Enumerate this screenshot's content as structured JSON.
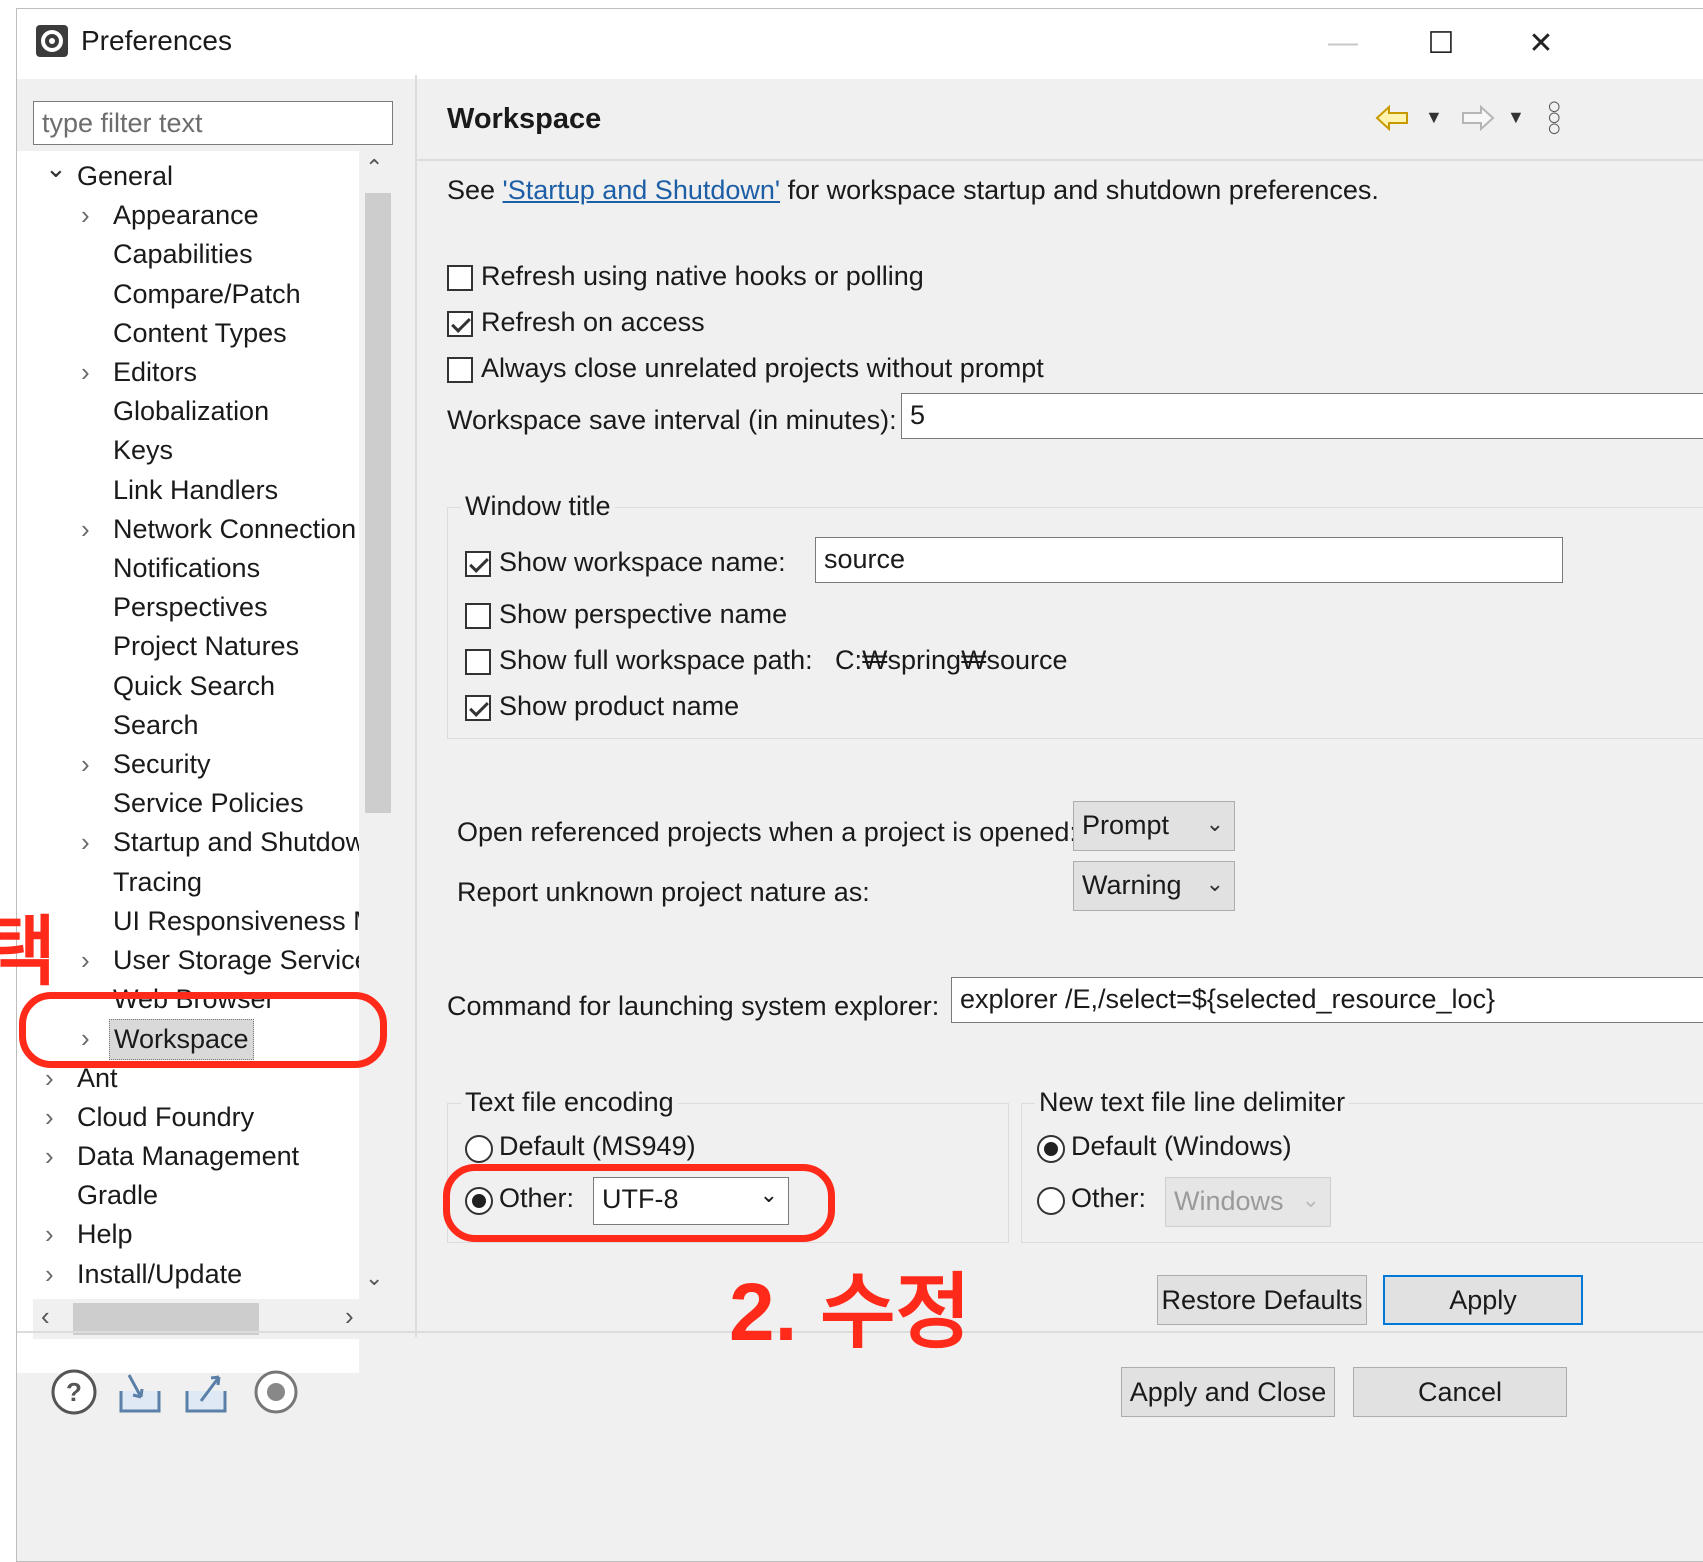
{
  "window": {
    "title": "Preferences",
    "minimize_glyph": "—",
    "maximize_glyph": "☐",
    "close_glyph": "✕"
  },
  "sidebar": {
    "filter_placeholder": "type filter text",
    "items": [
      {
        "label": "General",
        "level": 0,
        "expander": "expanded"
      },
      {
        "label": "Appearance",
        "level": 1,
        "expander": "collapsed"
      },
      {
        "label": "Capabilities",
        "level": 1,
        "expander": "none"
      },
      {
        "label": "Compare/Patch",
        "level": 1,
        "expander": "none"
      },
      {
        "label": "Content Types",
        "level": 1,
        "expander": "none"
      },
      {
        "label": "Editors",
        "level": 1,
        "expander": "collapsed"
      },
      {
        "label": "Globalization",
        "level": 1,
        "expander": "none"
      },
      {
        "label": "Keys",
        "level": 1,
        "expander": "none"
      },
      {
        "label": "Link Handlers",
        "level": 1,
        "expander": "none"
      },
      {
        "label": "Network Connection",
        "level": 1,
        "expander": "collapsed"
      },
      {
        "label": "Notifications",
        "level": 1,
        "expander": "none"
      },
      {
        "label": "Perspectives",
        "level": 1,
        "expander": "none"
      },
      {
        "label": "Project Natures",
        "level": 1,
        "expander": "none"
      },
      {
        "label": "Quick Search",
        "level": 1,
        "expander": "none"
      },
      {
        "label": "Search",
        "level": 1,
        "expander": "none"
      },
      {
        "label": "Security",
        "level": 1,
        "expander": "collapsed"
      },
      {
        "label": "Service Policies",
        "level": 1,
        "expander": "none"
      },
      {
        "label": "Startup and Shutdow",
        "level": 1,
        "expander": "collapsed"
      },
      {
        "label": "Tracing",
        "level": 1,
        "expander": "none"
      },
      {
        "label": "UI Responsiveness M",
        "level": 1,
        "expander": "none"
      },
      {
        "label": "User Storage Service",
        "level": 1,
        "expander": "collapsed"
      },
      {
        "label": "Web Browser",
        "level": 1,
        "expander": "none"
      },
      {
        "label": "Workspace",
        "level": 1,
        "expander": "collapsed",
        "selected": true
      },
      {
        "label": "Ant",
        "level": 0,
        "expander": "collapsed"
      },
      {
        "label": "Cloud Foundry",
        "level": 0,
        "expander": "collapsed"
      },
      {
        "label": "Data Management",
        "level": 0,
        "expander": "collapsed"
      },
      {
        "label": "Gradle",
        "level": 0,
        "expander": "none"
      },
      {
        "label": "Help",
        "level": 0,
        "expander": "collapsed"
      },
      {
        "label": "Install/Update",
        "level": 0,
        "expander": "collapsed"
      }
    ]
  },
  "page": {
    "title": "Workspace",
    "intro_prefix": "See ",
    "intro_link": "'Startup and Shutdown'",
    "intro_suffix": " for workspace startup and shutdown preferences.",
    "refresh_native": {
      "label": "Refresh using native hooks or polling",
      "checked": false
    },
    "refresh_access": {
      "label": "Refresh on access",
      "checked": true
    },
    "always_close": {
      "label": "Always close unrelated projects without prompt",
      "checked": false
    },
    "save_interval_label": "Workspace save interval (in minutes):",
    "save_interval_value": "5",
    "window_title_group": "Window title",
    "show_ws_name": {
      "label": "Show workspace name:",
      "checked": true,
      "value": "source"
    },
    "show_perspective": {
      "label": "Show perspective name",
      "checked": false
    },
    "show_full_path": {
      "label": "Show full workspace path:",
      "checked": false,
      "value": "C:₩spring₩source"
    },
    "show_product": {
      "label": "Show product name",
      "checked": true
    },
    "open_ref_label": "Open referenced projects when a project is opened:",
    "open_ref_value": "Prompt",
    "report_nature_label": "Report unknown project nature as:",
    "report_nature_value": "Warning",
    "explorer_label": "Command for launching system explorer:",
    "explorer_value": "explorer /E,/select=${selected_resource_loc}",
    "encoding_group": "Text file encoding",
    "encoding_default": {
      "label": "Default (MS949)",
      "checked": false
    },
    "encoding_other": {
      "label": "Other:",
      "checked": true,
      "value": "UTF-8"
    },
    "delimiter_group": "New text file line delimiter",
    "delimiter_default": {
      "label": "Default (Windows)",
      "checked": true
    },
    "delimiter_other": {
      "label": "Other:",
      "checked": false,
      "value": "Windows"
    },
    "restore_defaults": "Restore Defaults",
    "apply": "Apply"
  },
  "footer": {
    "apply_close": "Apply and Close",
    "cancel": "Cancel",
    "icons": [
      "help-icon",
      "import-icon",
      "export-icon",
      "record-icon"
    ]
  },
  "annotations": {
    "step1": "택",
    "step2": "2. 수정",
    "color": "#ff2a1a"
  }
}
